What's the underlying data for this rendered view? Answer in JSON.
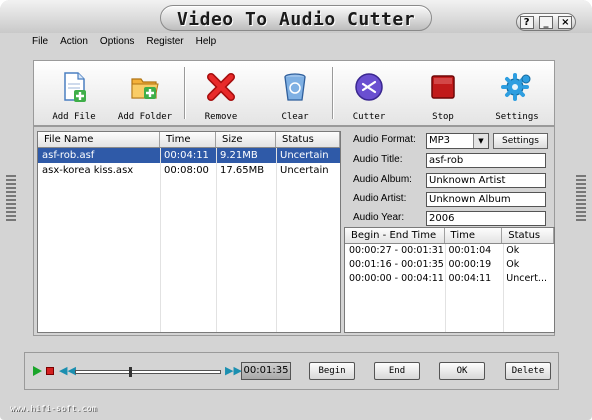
{
  "window": {
    "title": "Video To Audio Cutter",
    "controls": {
      "help": "?",
      "minimize": "_",
      "close": "×"
    }
  },
  "menu": [
    "File",
    "Action",
    "Options",
    "Register",
    "Help"
  ],
  "toolbar": {
    "add_file": "Add File",
    "add_folder": "Add Folder",
    "remove": "Remove",
    "clear": "Clear",
    "cutter": "Cutter",
    "stop": "Stop",
    "settings": "Settings"
  },
  "file_list": {
    "columns": [
      "File Name",
      "Time",
      "Size",
      "Status"
    ],
    "rows": [
      {
        "name": "asf-rob.asf",
        "time": "00:04:11",
        "size": "9.21MB",
        "status": "Uncertain",
        "selected": true
      },
      {
        "name": "asx-korea kiss.asx",
        "time": "00:08:00",
        "size": "17.65MB",
        "status": "Uncertain",
        "selected": false
      }
    ]
  },
  "properties": {
    "format_label": "Audio Format:",
    "format_value": "MP3",
    "format_settings": "Settings",
    "title_label": "Audio Title:",
    "title_value": "asf-rob",
    "album_label": "Audio Album:",
    "album_value": "Unknown Artist",
    "artist_label": "Audio Artist:",
    "artist_value": "Unknown Album",
    "year_label": "Audio Year:",
    "year_value": "2006"
  },
  "segments": {
    "columns": [
      "Begin - End Time",
      "Time",
      "Status"
    ],
    "rows": [
      {
        "range": "00:00:27 - 00:01:31",
        "time": "00:01:04",
        "status": "Ok"
      },
      {
        "range": "00:01:16 - 00:01:35",
        "time": "00:00:19",
        "status": "Ok"
      },
      {
        "range": "00:00:00 - 00:04:11",
        "time": "00:04:11",
        "status": "Uncert..."
      }
    ]
  },
  "player": {
    "time": "00:01:35",
    "position": 0.38,
    "begin": "Begin",
    "end": "End",
    "ok": "OK",
    "delete": "Delete"
  },
  "footer": {
    "url": "www.hifi-soft.com"
  },
  "colors": {
    "selection": "#2f5aa8",
    "chrome": "#d4d4d4"
  },
  "icons": [
    "add-file-icon",
    "add-folder-icon",
    "remove-icon",
    "clear-icon",
    "cutter-icon",
    "stop-icon",
    "settings-icon"
  ]
}
